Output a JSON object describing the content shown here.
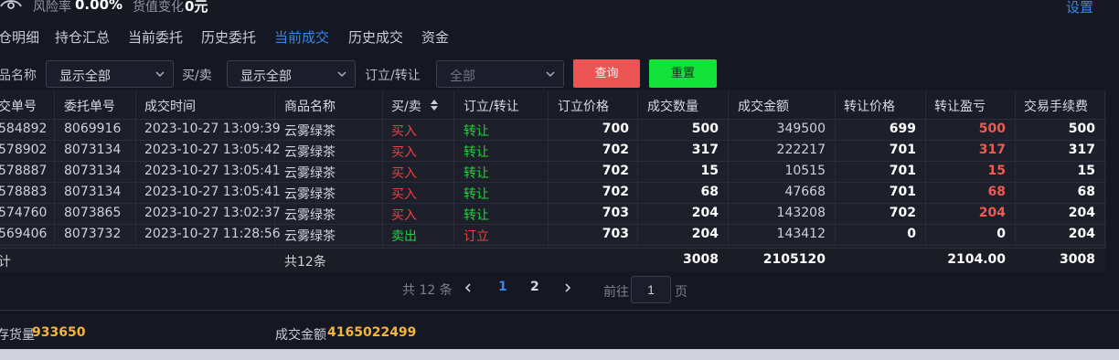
{
  "topbar": {
    "risk_label": "风险率",
    "risk_value": "0.00%",
    "change_label": "货值变化",
    "change_value": "0元",
    "settings_label": "设置"
  },
  "tabs": [
    {
      "label": "仓明细",
      "active": false
    },
    {
      "label": "持仓汇总",
      "active": false
    },
    {
      "label": "当前委托",
      "active": false
    },
    {
      "label": "历史委托",
      "active": false
    },
    {
      "label": "当前成交",
      "active": true
    },
    {
      "label": "历史成交",
      "active": false
    },
    {
      "label": "资金",
      "active": false
    }
  ],
  "filters": {
    "product_label": "品名称",
    "product_value": "显示全部",
    "side_label": "买/卖",
    "side_value": "显示全部",
    "type_label": "订立/转让",
    "type_placeholder": "全部",
    "query_label": "查询",
    "reset_label": "重置"
  },
  "table": {
    "headers": [
      "交单号",
      "委托单号",
      "成交时间",
      "商品名称",
      "买/卖",
      "订立/转让",
      "订立价格",
      "成交数量",
      "成交金额",
      "转让价格",
      "转让盈亏",
      "交易手续费"
    ],
    "rows": [
      {
        "deal_no": "584892",
        "order_no": "8069916",
        "time": "2023-10-27 13:09:39",
        "product": "云雾绿茶",
        "side": "买入",
        "type": "转让",
        "open_price": "700",
        "qty": "500",
        "amount": "349500",
        "close_price": "699",
        "pnl": "500",
        "fee": "500"
      },
      {
        "deal_no": "578902",
        "order_no": "8073134",
        "time": "2023-10-27 13:05:42",
        "product": "云雾绿茶",
        "side": "买入",
        "type": "转让",
        "open_price": "702",
        "qty": "317",
        "amount": "222217",
        "close_price": "701",
        "pnl": "317",
        "fee": "317"
      },
      {
        "deal_no": "578887",
        "order_no": "8073134",
        "time": "2023-10-27 13:05:41",
        "product": "云雾绿茶",
        "side": "买入",
        "type": "转让",
        "open_price": "702",
        "qty": "15",
        "amount": "10515",
        "close_price": "701",
        "pnl": "15",
        "fee": "15"
      },
      {
        "deal_no": "578883",
        "order_no": "8073134",
        "time": "2023-10-27 13:05:41",
        "product": "云雾绿茶",
        "side": "买入",
        "type": "转让",
        "open_price": "702",
        "qty": "68",
        "amount": "47668",
        "close_price": "701",
        "pnl": "68",
        "fee": "68"
      },
      {
        "deal_no": "574760",
        "order_no": "8073865",
        "time": "2023-10-27 13:02:37",
        "product": "云雾绿茶",
        "side": "买入",
        "type": "转让",
        "open_price": "703",
        "qty": "204",
        "amount": "143208",
        "close_price": "702",
        "pnl": "204",
        "fee": "204"
      },
      {
        "deal_no": "569406",
        "order_no": "8073732",
        "time": "2023-10-27 11:28:56",
        "product": "云雾绿茶",
        "side": "卖出",
        "type": "订立",
        "open_price": "703",
        "qty": "204",
        "amount": "143412",
        "close_price": "0",
        "pnl": "0",
        "fee": "204"
      }
    ],
    "summary": {
      "label": "计",
      "count": "共12条",
      "qty": "3008",
      "amount": "2105120",
      "pnl": "2104.00",
      "fee": "3008"
    }
  },
  "pager": {
    "total": "共 12 条",
    "pages": [
      "1",
      "2"
    ],
    "current": "1",
    "goto_label": "前往",
    "goto_value": "1",
    "goto_suffix": "页"
  },
  "footer": {
    "stock_label": "存货量",
    "stock_value": "933650",
    "amount_label": "成交金额",
    "amount_value": "4165022499"
  },
  "colors": {
    "accent": "#3a86e8",
    "buy": "#e8413f",
    "sell": "#22d13b",
    "highlight": "#f5b53b",
    "query_button": "#ec5454",
    "reset_button": "#12e23a"
  }
}
